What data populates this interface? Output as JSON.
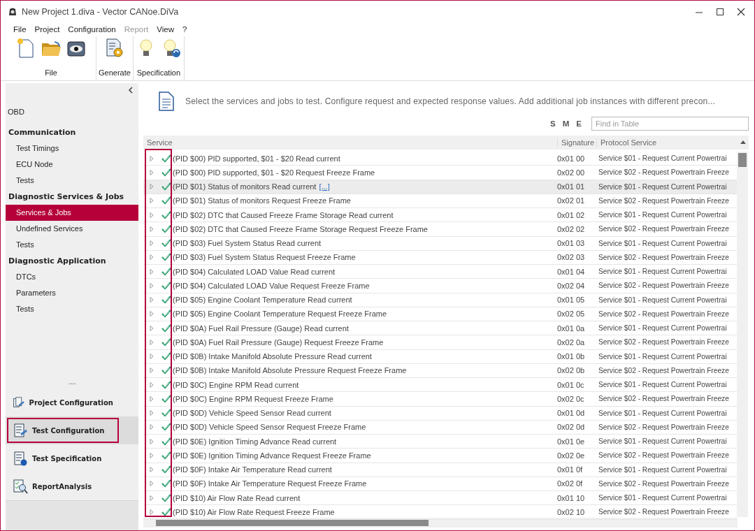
{
  "window": {
    "title": "New Project 1.diva - Vector CANoe.DiVa"
  },
  "menu": [
    {
      "label": "File",
      "disabled": false
    },
    {
      "label": "Project",
      "disabled": false
    },
    {
      "label": "Configuration",
      "disabled": false
    },
    {
      "label": "Report",
      "disabled": true
    },
    {
      "label": "View",
      "disabled": false
    },
    {
      "label": "?",
      "disabled": false
    }
  ],
  "ribbon": [
    {
      "label": "File",
      "buttons": [
        {
          "kind": "new"
        },
        {
          "kind": "open"
        },
        {
          "kind": "view"
        }
      ]
    },
    {
      "label": "Generate",
      "buttons": [
        {
          "kind": "generate"
        }
      ]
    },
    {
      "label": "Specification",
      "buttons": [
        {
          "kind": "bulb"
        },
        {
          "kind": "bulb-refresh"
        }
      ]
    }
  ],
  "sidebar": {
    "items": [
      {
        "label": "OBD",
        "kind": "root",
        "selected": false
      },
      {
        "label": "Communication",
        "kind": "heading",
        "selected": false
      },
      {
        "label": "Test Timings",
        "kind": "item",
        "selected": false
      },
      {
        "label": "ECU Node",
        "kind": "item",
        "selected": false
      },
      {
        "label": "Tests",
        "kind": "item",
        "selected": false
      },
      {
        "label": "Diagnostic Services & Jobs",
        "kind": "heading",
        "selected": false
      },
      {
        "label": "Services & Jobs",
        "kind": "item",
        "selected": true
      },
      {
        "label": "Undefined Services",
        "kind": "item",
        "selected": false
      },
      {
        "label": "Tests",
        "kind": "item",
        "selected": false
      },
      {
        "label": "Diagnostic Application",
        "kind": "heading",
        "selected": false
      },
      {
        "label": "DTCs",
        "kind": "item",
        "selected": false
      },
      {
        "label": "Parameters",
        "kind": "item",
        "selected": false
      },
      {
        "label": "Tests",
        "kind": "item",
        "selected": false
      }
    ],
    "splitter": "......",
    "nav": [
      {
        "label": "Project Configuration",
        "kind": "project",
        "selected": false
      },
      {
        "label": "Test Configuration",
        "kind": "config",
        "selected": true
      },
      {
        "label": "Test Specification",
        "kind": "spec",
        "selected": false
      },
      {
        "label": "ReportAnalysis",
        "kind": "report",
        "selected": false
      }
    ]
  },
  "description": "Select the services and jobs to test. Configure request and expected response values. Add additional job instances with different precon...",
  "filters": [
    "S",
    "M",
    "E"
  ],
  "search": {
    "placeholder": "Find in Table"
  },
  "table": {
    "columns": [
      "Service",
      "Signature",
      "Protocol Service"
    ],
    "rows": [
      {
        "service": "(PID $00) PID supported, $01 - $20 Read current",
        "signature": "0x01 00",
        "protocol": "Service $01 - Request Current Powertrai",
        "checked": true,
        "selected": false
      },
      {
        "service": "(PID $00) PID supported, $01 - $20 Request Freeze Frame",
        "signature": "0x02 00",
        "protocol": "Service $02 - Request Powertrain Freeze",
        "checked": true,
        "selected": false
      },
      {
        "service": "(PID $01) Status of monitors Read current",
        "link": "[...]",
        "signature": "0x01 01",
        "protocol": "Service $01 - Request Current Powertrai",
        "checked": true,
        "selected": true
      },
      {
        "service": "(PID $01) Status of monitors Request Freeze Frame",
        "signature": "0x02 01",
        "protocol": "Service $02 - Request Powertrain Freeze",
        "checked": true,
        "selected": false
      },
      {
        "service": "(PID $02) DTC that Caused Freeze Frame Storage Read current",
        "signature": "0x01 02",
        "protocol": "Service $01 - Request Current Powertrai",
        "checked": true,
        "selected": false
      },
      {
        "service": "(PID $02) DTC that Caused Freeze Frame Storage Request Freeze Frame",
        "signature": "0x02 02",
        "protocol": "Service $02 - Request Powertrain Freeze",
        "checked": true,
        "selected": false
      },
      {
        "service": "(PID $03) Fuel System Status Read current",
        "signature": "0x01 03",
        "protocol": "Service $01 - Request Current Powertrai",
        "checked": true,
        "selected": false
      },
      {
        "service": "(PID $03) Fuel System Status Request Freeze Frame",
        "signature": "0x02 03",
        "protocol": "Service $02 - Request Powertrain Freeze",
        "checked": true,
        "selected": false
      },
      {
        "service": "(PID $04) Calculated LOAD Value Read current",
        "signature": "0x01 04",
        "protocol": "Service $01 - Request Current Powertrai",
        "checked": true,
        "selected": false
      },
      {
        "service": "(PID $04) Calculated LOAD Value Request Freeze Frame",
        "signature": "0x02 04",
        "protocol": "Service $02 - Request Powertrain Freeze",
        "checked": true,
        "selected": false
      },
      {
        "service": "(PID $05) Engine Coolant Temperature Read current",
        "signature": "0x01 05",
        "protocol": "Service $01 - Request Current Powertrai",
        "checked": true,
        "selected": false
      },
      {
        "service": "(PID $05) Engine Coolant Temperature Request Freeze Frame",
        "signature": "0x02 05",
        "protocol": "Service $02 - Request Powertrain Freeze",
        "checked": true,
        "selected": false
      },
      {
        "service": "(PID $0A) Fuel Rail Pressure (Gauge) Read current",
        "signature": "0x01 0a",
        "protocol": "Service $01 - Request Current Powertrai",
        "checked": true,
        "selected": false
      },
      {
        "service": "(PID $0A) Fuel Rail Pressure (Gauge) Request Freeze Frame",
        "signature": "0x02 0a",
        "protocol": "Service $02 - Request Powertrain Freeze",
        "checked": true,
        "selected": false
      },
      {
        "service": "(PID $0B) Intake Manifold Absolute Pressure Read current",
        "signature": "0x01 0b",
        "protocol": "Service $01 - Request Current Powertrai",
        "checked": true,
        "selected": false
      },
      {
        "service": "(PID $0B) Intake Manifold Absolute Pressure Request Freeze Frame",
        "signature": "0x02 0b",
        "protocol": "Service $02 - Request Powertrain Freeze",
        "checked": true,
        "selected": false
      },
      {
        "service": "(PID $0C) Engine RPM Read current",
        "signature": "0x01 0c",
        "protocol": "Service $01 - Request Current Powertrai",
        "checked": true,
        "selected": false
      },
      {
        "service": "(PID $0C) Engine RPM Request Freeze Frame",
        "signature": "0x02 0c",
        "protocol": "Service $02 - Request Powertrain Freeze",
        "checked": true,
        "selected": false
      },
      {
        "service": "(PID $0D) Vehicle Speed Sensor Read current",
        "signature": "0x01 0d",
        "protocol": "Service $01 - Request Current Powertrai",
        "checked": true,
        "selected": false
      },
      {
        "service": "(PID $0D) Vehicle Speed Sensor Request Freeze Frame",
        "signature": "0x02 0d",
        "protocol": "Service $02 - Request Powertrain Freeze",
        "checked": true,
        "selected": false
      },
      {
        "service": "(PID $0E) Ignition Timing Advance Read current",
        "signature": "0x01 0e",
        "protocol": "Service $01 - Request Current Powertrai",
        "checked": true,
        "selected": false
      },
      {
        "service": "(PID $0E) Ignition Timing Advance Request Freeze Frame",
        "signature": "0x02 0e",
        "protocol": "Service $02 - Request Powertrain Freeze",
        "checked": true,
        "selected": false
      },
      {
        "service": "(PID $0F) Intake Air Temperature Read current",
        "signature": "0x01 0f",
        "protocol": "Service $01 - Request Current Powertrai",
        "checked": true,
        "selected": false
      },
      {
        "service": "(PID $0F) Intake Air Temperature Request Freeze Frame",
        "signature": "0x02 0f",
        "protocol": "Service $02 - Request Powertrain Freeze",
        "checked": true,
        "selected": false
      },
      {
        "service": "(PID $10) Air Flow Rate Read current",
        "signature": "0x01 10",
        "protocol": "Service $01 - Request Current Powertrai",
        "checked": true,
        "selected": false
      },
      {
        "service": "(PID $10) Air Flow Rate Request Freeze Frame",
        "signature": "0x02 10",
        "protocol": "Service $02 - Request Powertrain Freeze",
        "checked": true,
        "selected": false
      }
    ]
  }
}
